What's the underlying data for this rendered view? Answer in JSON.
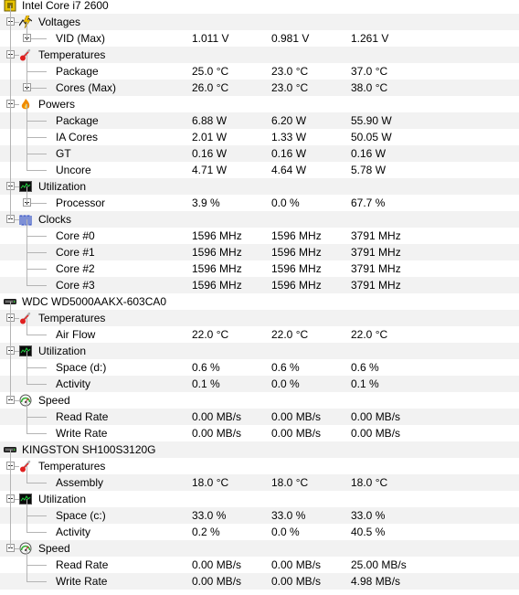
{
  "rows": [
    {
      "level": 0,
      "label": "Intel Core i7 2600",
      "icon": "cpu-chip-icon"
    },
    {
      "level": 1,
      "label": "Voltages",
      "icon": "voltage-icon",
      "toggle": "minus"
    },
    {
      "level": 2,
      "label": "VID (Max)",
      "toggle": "plus",
      "values": [
        "1.011 V",
        "0.981 V",
        "1.261 V"
      ]
    },
    {
      "level": 1,
      "label": "Temperatures",
      "icon": "thermometer-icon",
      "toggle": "minus"
    },
    {
      "level": 2,
      "label": "Package",
      "values": [
        "25.0 °C",
        "23.0 °C",
        "37.0 °C"
      ]
    },
    {
      "level": 2,
      "label": "Cores (Max)",
      "toggle": "plus",
      "values": [
        "26.0 °C",
        "23.0 °C",
        "38.0 °C"
      ]
    },
    {
      "level": 1,
      "label": "Powers",
      "icon": "flame-icon",
      "toggle": "minus"
    },
    {
      "level": 2,
      "label": "Package",
      "values": [
        "6.88 W",
        "6.20 W",
        "55.90 W"
      ]
    },
    {
      "level": 2,
      "label": "IA Cores",
      "values": [
        "2.01 W",
        "1.33 W",
        "50.05 W"
      ]
    },
    {
      "level": 2,
      "label": "GT",
      "values": [
        "0.16 W",
        "0.16 W",
        "0.16 W"
      ]
    },
    {
      "level": 2,
      "label": "Uncore",
      "values": [
        "4.71 W",
        "4.64 W",
        "5.78 W"
      ]
    },
    {
      "level": 1,
      "label": "Utilization",
      "icon": "monitor-graph-icon",
      "toggle": "minus"
    },
    {
      "level": 2,
      "label": "Processor",
      "toggle": "plus",
      "values": [
        "3.9 %",
        "0.0 %",
        "67.7 %"
      ]
    },
    {
      "level": 1,
      "label": "Clocks",
      "icon": "clock-wave-icon",
      "toggle": "minus"
    },
    {
      "level": 2,
      "label": "Core #0",
      "values": [
        "1596 MHz",
        "1596 MHz",
        "3791 MHz"
      ]
    },
    {
      "level": 2,
      "label": "Core #1",
      "values": [
        "1596 MHz",
        "1596 MHz",
        "3791 MHz"
      ]
    },
    {
      "level": 2,
      "label": "Core #2",
      "values": [
        "1596 MHz",
        "1596 MHz",
        "3791 MHz"
      ]
    },
    {
      "level": 2,
      "label": "Core #3",
      "values": [
        "1596 MHz",
        "1596 MHz",
        "3791 MHz"
      ]
    },
    {
      "level": 0,
      "label": "WDC WD5000AAKX-603CA0",
      "icon": "hard-drive-icon"
    },
    {
      "level": 1,
      "label": "Temperatures",
      "icon": "thermometer-icon",
      "toggle": "minus"
    },
    {
      "level": 2,
      "label": "Air Flow",
      "values": [
        "22.0 °C",
        "22.0 °C",
        "22.0 °C"
      ]
    },
    {
      "level": 1,
      "label": "Utilization",
      "icon": "monitor-graph-icon",
      "toggle": "minus"
    },
    {
      "level": 2,
      "label": "Space (d:)",
      "values": [
        "0.6 %",
        "0.6 %",
        "0.6 %"
      ]
    },
    {
      "level": 2,
      "label": "Activity",
      "values": [
        "0.1 %",
        "0.0 %",
        "0.1 %"
      ]
    },
    {
      "level": 1,
      "label": "Speed",
      "icon": "speedometer-icon",
      "toggle": "minus"
    },
    {
      "level": 2,
      "label": "Read Rate",
      "values": [
        "0.00 MB/s",
        "0.00 MB/s",
        "0.00 MB/s"
      ]
    },
    {
      "level": 2,
      "label": "Write Rate",
      "values": [
        "0.00 MB/s",
        "0.00 MB/s",
        "0.00 MB/s"
      ]
    },
    {
      "level": 0,
      "label": "KINGSTON SH100S3120G",
      "icon": "hard-drive-icon"
    },
    {
      "level": 1,
      "label": "Temperatures",
      "icon": "thermometer-icon",
      "toggle": "minus"
    },
    {
      "level": 2,
      "label": "Assembly",
      "values": [
        "18.0 °C",
        "18.0 °C",
        "18.0 °C"
      ]
    },
    {
      "level": 1,
      "label": "Utilization",
      "icon": "monitor-graph-icon",
      "toggle": "minus"
    },
    {
      "level": 2,
      "label": "Space (c:)",
      "values": [
        "33.0 %",
        "33.0 %",
        "33.0 %"
      ]
    },
    {
      "level": 2,
      "label": "Activity",
      "values": [
        "0.2 %",
        "0.0 %",
        "40.5 %"
      ]
    },
    {
      "level": 1,
      "label": "Speed",
      "icon": "speedometer-icon",
      "toggle": "minus"
    },
    {
      "level": 2,
      "label": "Read Rate",
      "values": [
        "0.00 MB/s",
        "0.00 MB/s",
        "25.00 MB/s"
      ]
    },
    {
      "level": 2,
      "label": "Write Rate",
      "values": [
        "0.00 MB/s",
        "0.00 MB/s",
        "4.98 MB/s"
      ]
    }
  ],
  "colors": {
    "row_alt": "#f2f2f2",
    "text": "#000000",
    "tree_line": "#b4b4b4"
  }
}
